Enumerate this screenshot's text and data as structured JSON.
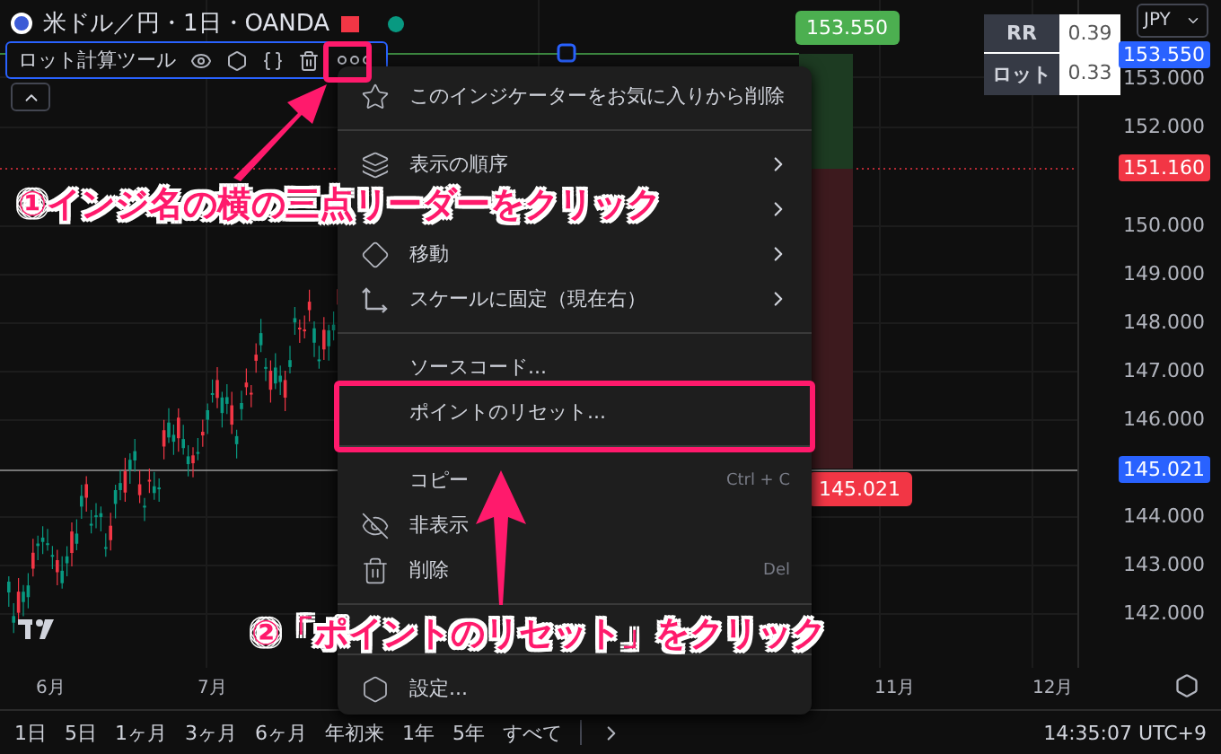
{
  "chart_header": {
    "symbol": "米ドル／円・1日・OANDA"
  },
  "indicator": {
    "name": "ロット計算ツール"
  },
  "position_tool": {
    "top_label": "153.550",
    "bottom_label": "145.021"
  },
  "stats_table": {
    "rows": [
      {
        "label": "RR",
        "value": "0.39"
      },
      {
        "label": "ロット",
        "value": "0.33"
      }
    ]
  },
  "currency_select": {
    "value": "JPY"
  },
  "price_axis": {
    "labels": [
      {
        "text": "153.550",
        "kind": "tag",
        "color": "#2962ff"
      },
      {
        "text": "153.000",
        "kind": "plain"
      },
      {
        "text": "152.000",
        "kind": "plain"
      },
      {
        "text": "151.160",
        "kind": "tag",
        "color": "#f23645"
      },
      {
        "text": "150.000",
        "kind": "plain"
      },
      {
        "text": "149.000",
        "kind": "plain"
      },
      {
        "text": "148.000",
        "kind": "plain"
      },
      {
        "text": "147.000",
        "kind": "plain"
      },
      {
        "text": "146.000",
        "kind": "plain"
      },
      {
        "text": "145.021",
        "kind": "tag",
        "color": "#2962ff"
      },
      {
        "text": "144.000",
        "kind": "plain"
      },
      {
        "text": "143.000",
        "kind": "plain"
      },
      {
        "text": "142.000",
        "kind": "plain"
      }
    ]
  },
  "time_axis": {
    "labels": [
      "6月",
      "7月",
      "11月",
      "12月"
    ]
  },
  "range_bar": {
    "ranges": [
      "1日",
      "5日",
      "1ヶ月",
      "3ヶ月",
      "6ヶ月",
      "年初来",
      "1年",
      "5年",
      "すべて"
    ],
    "clock": "14:35:07 UTC+9"
  },
  "context_menu": {
    "items": [
      {
        "kind": "action",
        "label": "このインジケーターをお気に入りから削除"
      },
      {
        "kind": "divider"
      },
      {
        "kind": "submenu",
        "label": "表示の順序"
      },
      {
        "kind": "submenu"
      },
      {
        "kind": "submenu",
        "label": "移動"
      },
      {
        "kind": "submenu",
        "label": "スケールに固定（現在右）"
      },
      {
        "kind": "divider"
      },
      {
        "kind": "action",
        "label": "ソースコード..."
      },
      {
        "kind": "action",
        "label": "ポイントのリセット..."
      },
      {
        "kind": "divider"
      },
      {
        "kind": "action",
        "label": "コピー",
        "shortcut": "Ctrl + C"
      },
      {
        "kind": "action",
        "label": "非表示"
      },
      {
        "kind": "action",
        "label": "削除",
        "shortcut": "Del"
      },
      {
        "kind": "divider"
      },
      {
        "kind": "divider"
      },
      {
        "kind": "action",
        "label": "設定..."
      }
    ]
  },
  "annotations": [
    {
      "text": "①インジ名の横の三点リーダーをクリック"
    },
    {
      "text": "②「ポイントのリセット」をクリック"
    }
  ]
}
